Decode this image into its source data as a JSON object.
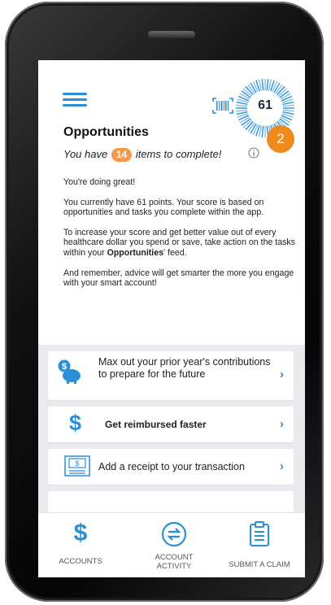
{
  "header": {
    "score": "61",
    "notification_count": "2",
    "title": "Opportunities",
    "subtitle_prefix": "You have",
    "items_count": "14",
    "subtitle_suffix": "items to complete!",
    "icons": [
      "menu-icon",
      "barcode-icon",
      "info-icon"
    ]
  },
  "body": {
    "p1": "You're doing great!",
    "p2": "You currently have 61 points. Your score is based on opportunities and tasks you complete within the app.",
    "p3_before": "To increase your score and get better value out of every healthcare dollar you spend or save, take action on the tasks within your",
    "p3_bold": "Opportunities",
    "p3_after": "' feed.",
    "p4": "And remember, advice will get smarter the more you engage with your smart account!"
  },
  "cards": [
    {
      "label": "Max out your prior year's contributions to prepare for the future",
      "icon": "piggy-bank-icon"
    },
    {
      "label": "Get reimbursed faster",
      "icon": "dollar-icon"
    },
    {
      "label": "Add a receipt to your transaction",
      "icon": "receipt-icon"
    }
  ],
  "tabs": [
    {
      "label": "ACCOUNTS",
      "icon": "dollar-icon"
    },
    {
      "label": "ACCOUNT\nACTIVITY",
      "icon": "transfer-icon"
    },
    {
      "label": "SUBMIT A CLAIM",
      "icon": "clipboard-icon"
    }
  ],
  "colors": {
    "accent": "#2a8fd6",
    "badge": "#ef8a1e",
    "pill": "#f2994a",
    "feed_bg": "#e9e9ee"
  }
}
